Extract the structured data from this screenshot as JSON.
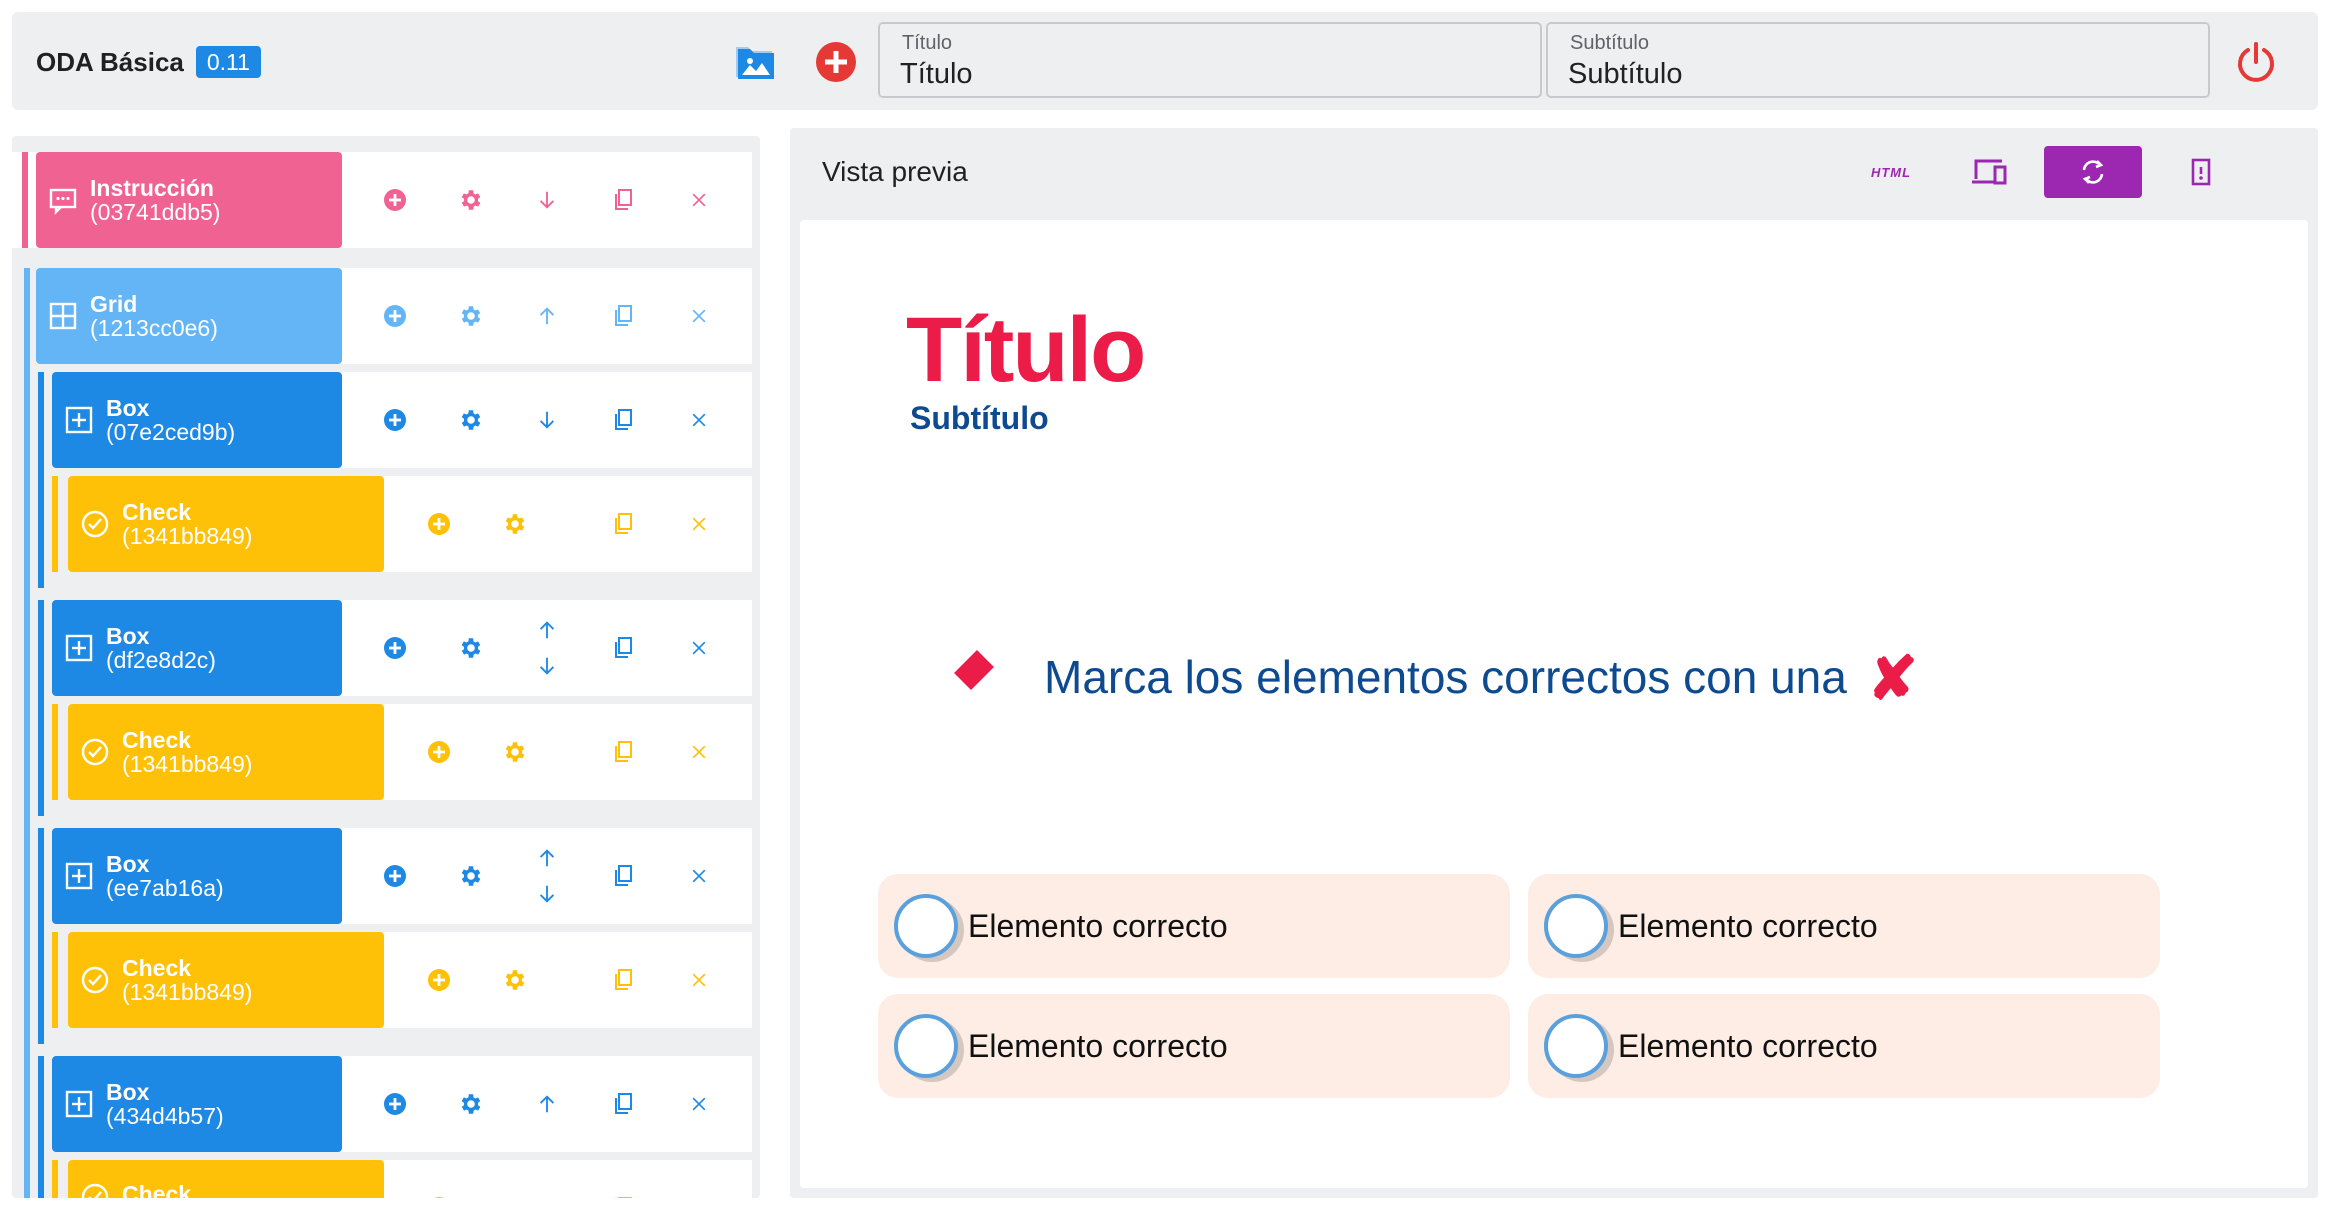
{
  "app": {
    "name": "ODA Básica",
    "version": "0.11"
  },
  "fields": {
    "title": {
      "label": "Título",
      "value": "Título"
    },
    "subtitle": {
      "label": "Subtítulo",
      "value": "Subtítulo"
    }
  },
  "tree": [
    {
      "name": "Instrucción",
      "id": "(03741ddb5)",
      "type": "instruction"
    },
    {
      "name": "Grid",
      "id": "(1213cc0e6)",
      "type": "grid"
    },
    {
      "name": "Box",
      "id": "(07e2ced9b)",
      "type": "box"
    },
    {
      "name": "Check",
      "id": "(1341bb849)",
      "type": "check"
    },
    {
      "name": "Box",
      "id": "(df2e8d2c)",
      "type": "box"
    },
    {
      "name": "Check",
      "id": "(1341bb849)",
      "type": "check"
    },
    {
      "name": "Box",
      "id": "(ee7ab16a)",
      "type": "box"
    },
    {
      "name": "Check",
      "id": "(1341bb849)",
      "type": "check"
    },
    {
      "name": "Box",
      "id": "(434d4b57)",
      "type": "box"
    },
    {
      "name": "Check",
      "id": "",
      "type": "check"
    }
  ],
  "preview": {
    "header": "Vista previa",
    "html_label": "HTML",
    "title": "Título",
    "subtitle": "Subtítulo",
    "instruction": "Marca los elementos correctos con una",
    "instruction_mark": "✘",
    "options": [
      "Elemento correcto",
      "Elemento correcto",
      "Elemento correcto",
      "Elemento correcto"
    ]
  },
  "colors": {
    "instruction": "#f06292",
    "grid": "#64b5f6",
    "box": "#1e88e5",
    "check": "#ffc107",
    "accent_red": "#ec1c48",
    "accent_blue": "#0d4a8f",
    "purple": "#9c27b0"
  },
  "icons": {
    "top": [
      "image-library-icon",
      "add-circle-icon",
      "power-icon"
    ],
    "actions": [
      "add-icon",
      "settings-icon",
      "move-icon",
      "duplicate-icon",
      "delete-icon"
    ],
    "preview_toolbar": [
      "html-icon",
      "devices-icon",
      "refresh-icon",
      "file-icon"
    ]
  }
}
